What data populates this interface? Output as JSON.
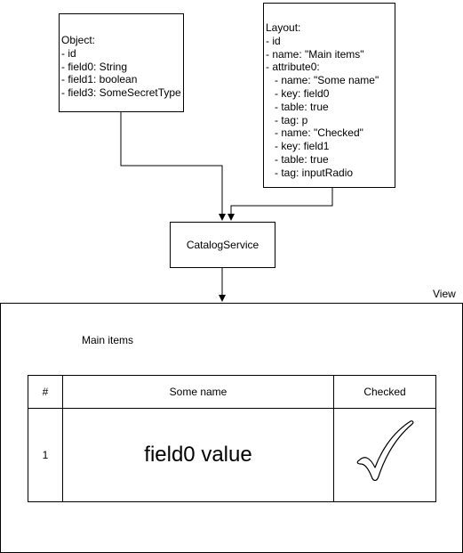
{
  "object_box": {
    "lines": [
      "Object:",
      "- id",
      "- field0: String",
      "- field1: boolean",
      "- field3: SomeSecretType"
    ]
  },
  "layout_box": {
    "lines": [
      "Layout:",
      "- id",
      "- name: \"Main items\"",
      "- attribute0:",
      "   - name: \"Some name\"",
      "   - key: field0",
      "   - table: true",
      "   - tag: p",
      "   - name: \"Checked\"",
      "   - key: field1",
      "   - table: true",
      "   - tag: inputRadio"
    ]
  },
  "service_box": {
    "label": "CatalogService"
  },
  "view": {
    "label": "View",
    "title": "Main items",
    "table": {
      "headers": [
        "#",
        "Some name",
        "Checked"
      ],
      "rows": [
        {
          "num": "1",
          "name": "field0 value",
          "checked_icon": "checkmark-icon"
        }
      ]
    }
  }
}
